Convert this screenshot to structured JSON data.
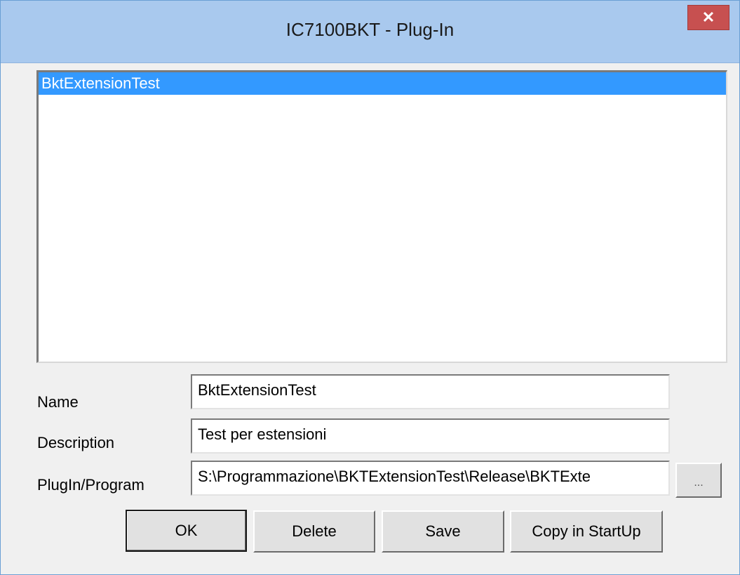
{
  "window": {
    "title": "IC7100BKT - Plug-In",
    "close_glyph": "✕"
  },
  "plugin_list": {
    "items": [
      "BktExtensionTest"
    ],
    "selected_index": 0
  },
  "form": {
    "name_label": "Name",
    "name_value": "BktExtensionTest",
    "description_label": "Description",
    "description_value": "Test per estensioni",
    "program_label": "PlugIn/Program",
    "program_value": "S:\\Programmazione\\BKTExtensionTest\\Release\\BKTExte",
    "browse_label": "..."
  },
  "buttons": {
    "ok": "OK",
    "delete": "Delete",
    "save": "Save",
    "copy_startup": "Copy in StartUp"
  },
  "colors": {
    "selection": "#3399ff",
    "titlebar": "#a9c9ee",
    "close": "#c75050"
  }
}
